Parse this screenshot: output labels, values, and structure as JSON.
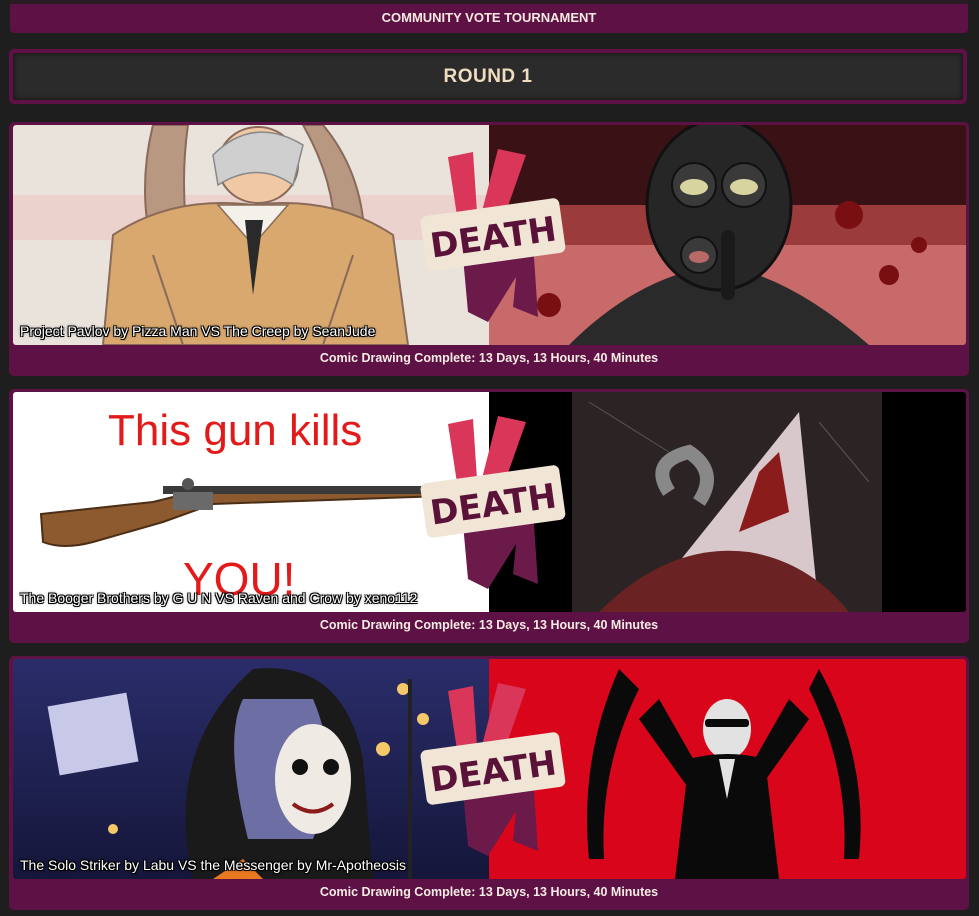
{
  "header": {
    "tournament_label": "COMMUNITY VOTE TOURNAMENT"
  },
  "round": {
    "title": "ROUND 1"
  },
  "logo": {
    "text": "DEATH",
    "mark": "VS"
  },
  "matchups": [
    {
      "caption": "Project Pavlov by Pizza Man VS The Creep by SeanJude",
      "status": "Comic Drawing Complete: 13 Days, 13 Hours, 40 Minutes"
    },
    {
      "caption": "The Booger Brothers by G U N VS Raven and Crow by xeno112",
      "status": "Comic Drawing Complete: 13 Days, 13 Hours, 40 Minutes",
      "left_image_text_top": "This gun kills",
      "left_image_text_bottom": "YOU!"
    },
    {
      "caption": "The Solo Striker by Labu VS the Messenger by Mr-Apotheosis",
      "status": "Comic Drawing Complete: 13 Days, 13 Hours, 40 Minutes"
    }
  ],
  "colors": {
    "page_bg": "#1e1e1e",
    "panel": "#5e1144",
    "round_inner": "#2b2b2b",
    "title_text": "#f0dcc0",
    "vs_pink": "#d9365a",
    "vs_purple": "#6b1a4a"
  }
}
